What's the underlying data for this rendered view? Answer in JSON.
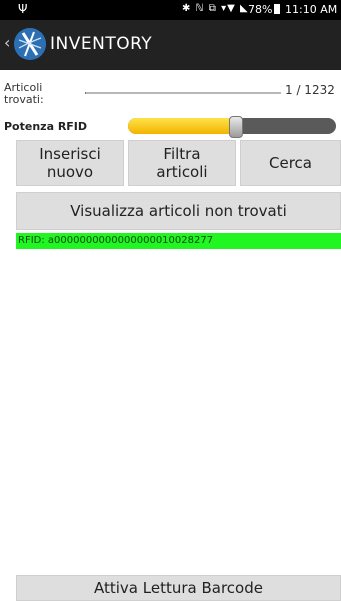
{
  "status_bar": {
    "usb_icon": "usb-icon",
    "icons_glyphs": "✱ ℕ ⧉ ▾▼ ◣",
    "battery": "78%",
    "time": "11:10 AM"
  },
  "app_bar": {
    "back_glyph": "‹",
    "logo_icon": "inventory-logo-icon",
    "title": "INVENTORY"
  },
  "found": {
    "label_line1": "Articoli",
    "label_line2": "trovati:",
    "progress_fraction": 0.001,
    "count_text": "1 / 1232"
  },
  "rfid_power": {
    "label": "Potenza RFID",
    "level_fraction": 0.52,
    "accent": "#f3b400"
  },
  "buttons": {
    "insert_line1": "Inserisci",
    "insert_line2": "nuovo",
    "filter_line1": "Filtra",
    "filter_line2": "articoli",
    "search": "Cerca",
    "show_not_found": "Visualizza articoli non trovati",
    "barcode": "Attiva Lettura Barcode"
  },
  "rfid_list": [
    {
      "text": "RFID: a0000000000000000010028277",
      "color": "#22f622"
    }
  ]
}
